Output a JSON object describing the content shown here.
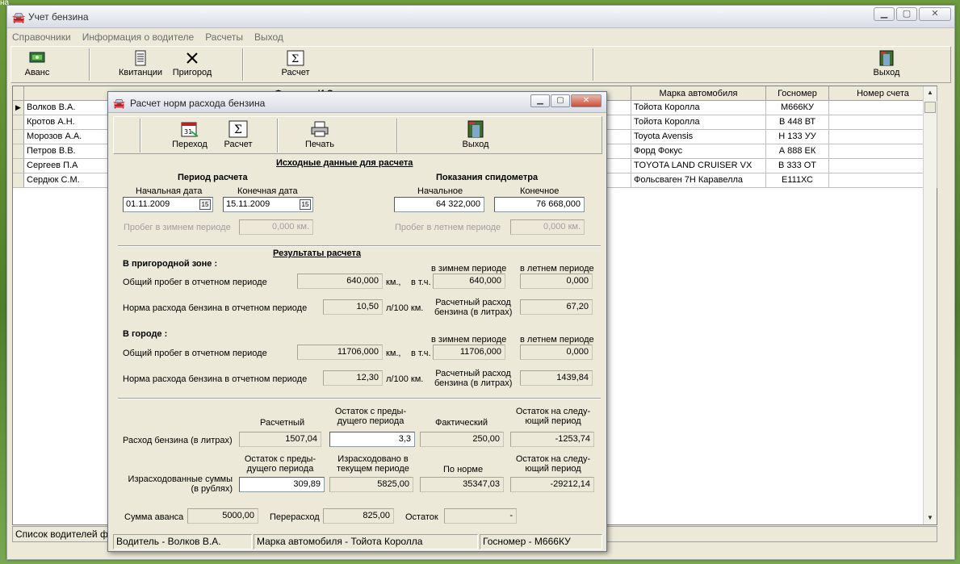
{
  "edge_text": "на",
  "main_window": {
    "title": "Учет бензина",
    "menu": [
      "Справочники",
      "Информация о водителе",
      "Расчеты",
      "Выход"
    ],
    "toolbar": {
      "avans": "Аванс",
      "kvitancii": "Квитанции",
      "prigorod": "Пригород",
      "raschet": "Расчет",
      "vyhod": "Выход"
    },
    "grid": {
      "headers": [
        "Фамилия И.О. водителя",
        "Марка автомобиля",
        "Госномер",
        "Номер счета"
      ],
      "rows": [
        {
          "name": "Волков В.А.",
          "car": "Тойота Королла",
          "plate": "М666КУ",
          "account": ""
        },
        {
          "name": "Кротов А.Н.",
          "car": "Тойота Королла",
          "plate": "В 448 ВТ",
          "account": ""
        },
        {
          "name": "Морозов А.А.",
          "car": "Toyota Avensis",
          "plate": "Н 133 УУ",
          "account": ""
        },
        {
          "name": "Петров В.В.",
          "car": "Форд Фокус",
          "plate": "А 888 ЕК",
          "account": ""
        },
        {
          "name": "Сергеев П.А",
          "car": "TOYOTA LAND CRUISER VX",
          "plate": "В 333 ОТ",
          "account": ""
        },
        {
          "name": "Сердюк С.М.",
          "car": "Фольсваген 7Н Каравелла",
          "plate": "Е111ХС",
          "account": ""
        }
      ]
    },
    "status": "Список водителей фи"
  },
  "dialog": {
    "title": "Расчет норм расхода бензина",
    "toolbar": {
      "perehod": "Переход",
      "raschet": "Расчет",
      "pechat": "Печать",
      "vyhod": "Выход"
    },
    "source": {
      "heading": "Исходные данные для расчета",
      "period_heading": "Период расчета",
      "start_label": "Начальная дата",
      "end_label": "Конечная дата",
      "start_date": "01.11.2009",
      "end_date": "15.11.2009",
      "winter_label": "Пробег в зимнем периоде",
      "winter_value": "0,000 км.",
      "speed_heading": "Показания спидометра",
      "speed_start_label": "Начальное",
      "speed_end_label": "Конечное",
      "speed_start": "64 322,000",
      "speed_end": "76 668,000",
      "summer_label": "Пробег в летнем периоде",
      "summer_value": "0,000 км."
    },
    "results": {
      "heading": "Результаты расчета",
      "suburb": {
        "title": "В пригородной зоне :",
        "winter_head": "в зимнем периоде",
        "summer_head": "в летнем периоде",
        "mileage_label": "Общий пробег в отчетном периоде",
        "mileage": "640,000",
        "km": "км.,",
        "incl": "в т.ч.",
        "winter": "640,000",
        "summer": "0,000",
        "norm_label": "Норма расхода бензина в отчетном периоде",
        "norm": "10,50",
        "norm_unit": "л/100 км.",
        "calc_label_1": "Расчетный расход",
        "calc_label_2": "бензина (в литрах)",
        "calc": "67,20"
      },
      "city": {
        "title": "В городе :",
        "winter_head": "в зимнем периоде",
        "summer_head": "в летнем периоде",
        "mileage_label": "Общий пробег в отчетном периоде",
        "mileage": "11706,000",
        "km": "км.,",
        "incl": "в т.ч.",
        "winter": "11706,000",
        "summer": "0,000",
        "norm_label": "Норма расхода бензина в отчетном периоде",
        "norm": "12,30",
        "norm_unit": "л/100 км.",
        "calc_label_1": "Расчетный расход",
        "calc_label_2": "бензина (в литрах)",
        "calc": "1439,84"
      }
    },
    "summary": {
      "col1": "Расчетный",
      "col2_1": "Остаток с преды-",
      "col2_2": "дущего периода",
      "col3": "Фактический",
      "col4_1": "Остаток на следу-",
      "col4_2": "ющий период",
      "fuel_label": "Расход бензина (в литрах)",
      "fuel_calc": "1507,04",
      "fuel_prev": "3,3",
      "fuel_fact": "250,00",
      "fuel_next": "-1253,74",
      "sum_col1_1": "Остаток с преды-",
      "sum_col1_2": "дущего периода",
      "sum_col2_1": "Израсходовано в",
      "sum_col2_2": "текущем периоде",
      "sum_col3": "По норме",
      "sum_col4_1": "Остаток на следу-",
      "sum_col4_2": "ющий период",
      "spent_label_1": "Израсходованные суммы",
      "spent_label_2": "(в рублях)",
      "spent_prev": "309,89",
      "spent_cur": "5825,00",
      "spent_norm": "35347,03",
      "spent_next": "-29212,14",
      "advance_label": "Сумма аванса",
      "advance": "5000,00",
      "overspend_label": "Перерасход",
      "overspend": "825,00",
      "remainder_label": "Остаток",
      "remainder": "-"
    },
    "status": {
      "driver": "Водитель - Волков В.А.",
      "car": "Марка автомобиля - Тойота Королла",
      "plate": "Госномер - М666КУ"
    }
  }
}
